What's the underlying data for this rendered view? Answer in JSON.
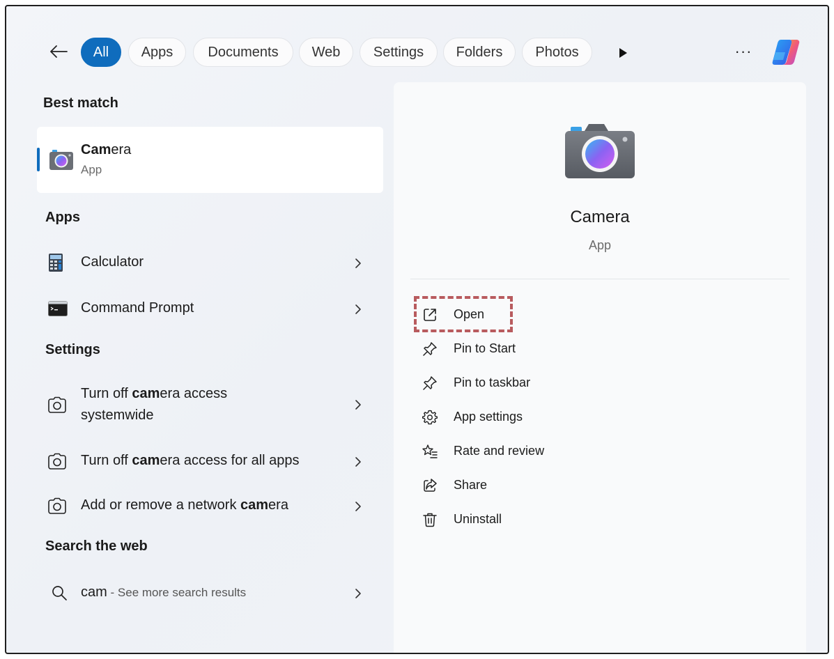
{
  "filter_bar": {
    "back_icon": "arrow-left-icon",
    "chips": [
      {
        "label": "All",
        "active": true
      },
      {
        "label": "Apps",
        "active": false
      },
      {
        "label": "Documents",
        "active": false
      },
      {
        "label": "Web",
        "active": false
      },
      {
        "label": "Settings",
        "active": false
      },
      {
        "label": "Folders",
        "active": false
      },
      {
        "label": "Photos",
        "active": false
      }
    ],
    "more_label": "···",
    "play_icon": "play-icon",
    "copilot_icon": "copilot-icon"
  },
  "best_match": {
    "title": "Best match",
    "item": {
      "name_bold": "Cam",
      "name_rest": "era",
      "type": "App",
      "icon": "camera-icon"
    }
  },
  "apps": {
    "title": "Apps",
    "items": [
      {
        "label": "Calculator",
        "icon": "calculator-icon"
      },
      {
        "label": "Command Prompt",
        "icon": "command-prompt-icon"
      }
    ]
  },
  "settings": {
    "title": "Settings",
    "items": [
      {
        "pre": "Turn off ",
        "bold": "cam",
        "post": "era access",
        "line2": "systemwide",
        "icon": "camera-outline-icon"
      },
      {
        "pre": "Turn off ",
        "bold": "cam",
        "post": "era access for all apps",
        "icon": "camera-outline-icon"
      },
      {
        "pre": "Add or remove a network ",
        "bold": "cam",
        "post": "era",
        "icon": "camera-outline-icon"
      }
    ]
  },
  "web": {
    "title": "Search the web",
    "query": "cam",
    "suffix": " - See more search results",
    "icon": "search-icon"
  },
  "detail": {
    "title": "Camera",
    "subtitle": "App",
    "actions": [
      {
        "label": "Open",
        "icon": "open-external-icon"
      },
      {
        "label": "Pin to Start",
        "icon": "pin-icon"
      },
      {
        "label": "Pin to taskbar",
        "icon": "pin-icon"
      },
      {
        "label": "App settings",
        "icon": "gear-icon"
      },
      {
        "label": "Rate and review",
        "icon": "star-list-icon"
      },
      {
        "label": "Share",
        "icon": "share-icon"
      },
      {
        "label": "Uninstall",
        "icon": "trash-icon"
      }
    ]
  },
  "colors": {
    "accent": "#0f6cbd",
    "highlight": "#e3141b"
  }
}
